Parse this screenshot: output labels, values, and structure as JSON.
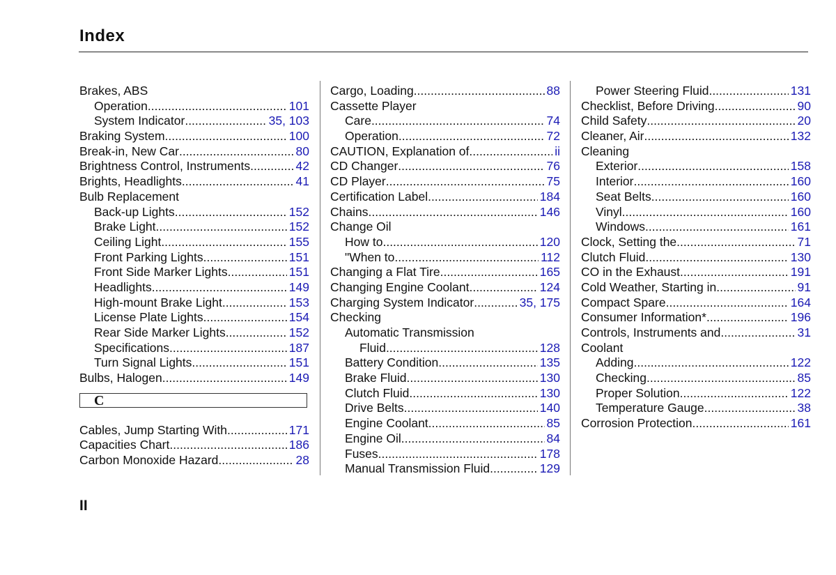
{
  "header": {
    "title": "Index"
  },
  "footer": {
    "page_number": "II"
  },
  "colors": {
    "page_number_link": "#1a1ab4",
    "text": "#111111"
  },
  "columns": [
    {
      "entries_top": [
        {
          "label": "Brakes, ABS",
          "page": "",
          "level": 0
        },
        {
          "label": "Operation",
          "page": "101",
          "level": 1
        },
        {
          "label": "System Indicator",
          "page": "35, 103",
          "level": 1
        },
        {
          "label": "Braking System",
          "page": "100",
          "level": 0
        },
        {
          "label": "Break-in, New Car",
          "page": "80",
          "level": 0
        },
        {
          "label": "Brightness Control, Instruments",
          "page": "42",
          "level": 0
        },
        {
          "label": "Brights, Headlights",
          "page": "41",
          "level": 0
        },
        {
          "label": "Bulb  Replacement",
          "page": "",
          "level": 0
        },
        {
          "label": "Back-up Lights",
          "page": "152",
          "level": 1
        },
        {
          "label": "Brake Light",
          "page": "152",
          "level": 1
        },
        {
          "label": "Ceiling Light",
          "page": "155",
          "level": 1
        },
        {
          "label": "Front Parking Lights",
          "page": "151",
          "level": 1
        },
        {
          "label": "Front Side Marker Lights",
          "page": "151",
          "level": 1
        },
        {
          "label": "Headlights",
          "page": "149",
          "level": 1
        },
        {
          "label": "High-mount Brake Light",
          "page": "153",
          "level": 1
        },
        {
          "label": "License Plate Lights",
          "page": "154",
          "level": 1
        },
        {
          "label": "Rear Side Marker Lights",
          "page": "152",
          "level": 1
        },
        {
          "label": "Specifications",
          "page": "187",
          "level": 1
        },
        {
          "label": "Turn Signal Lights",
          "page": "151",
          "level": 1
        },
        {
          "label": "Bulbs, Halogen",
          "page": "149",
          "level": 0
        }
      ],
      "section_letter": "C",
      "entries_bottom": [
        {
          "label": "Cables, Jump Starting With",
          "page": "171",
          "level": 0
        },
        {
          "label": "Capacities Chart",
          "page": "186",
          "level": 0
        },
        {
          "label": "Carbon Monoxide Hazard",
          "page": "28",
          "level": 0
        }
      ]
    },
    {
      "entries": [
        {
          "label": "Cargo, Loading",
          "page": "88",
          "level": 0
        },
        {
          "label": "Cassette Player",
          "page": "",
          "level": 0
        },
        {
          "label": "Care",
          "page": "74",
          "level": 1
        },
        {
          "label": "Operation",
          "page": "72",
          "level": 1
        },
        {
          "label": "CAUTION, Explanation of",
          "page": "ii",
          "level": 0
        },
        {
          "label": "CD Changer",
          "page": "76",
          "level": 0
        },
        {
          "label": "CD Player",
          "page": "75",
          "level": 0
        },
        {
          "label": "Certification Label",
          "page": "184",
          "level": 0
        },
        {
          "label": "Chains",
          "page": "146",
          "level": 0
        },
        {
          "label": "Change Oil",
          "page": "",
          "level": 0
        },
        {
          "label": "How to",
          "page": "120",
          "level": 1
        },
        {
          "label": "\"When to",
          "page": "112",
          "level": 1
        },
        {
          "label": "Changing a Flat Tire ",
          "page": "165",
          "level": 0
        },
        {
          "label": "Changing Engine Coolant",
          "page": "124",
          "level": 0
        },
        {
          "label": "Charging System Indicator",
          "page": "35, 175",
          "level": 0
        },
        {
          "label": "Checking",
          "page": "",
          "level": 0
        },
        {
          "label": "Automatic Transmission",
          "page": "",
          "level": 1
        },
        {
          "label": "Fluid",
          "page": "128",
          "level": 2
        },
        {
          "label": "Battery Condition",
          "page": "135",
          "level": 1
        },
        {
          "label": "Brake Fluid",
          "page": "130",
          "level": 1
        },
        {
          "label": "Clutch Fluid",
          "page": "130",
          "level": 1
        },
        {
          "label": "Drive Belts",
          "page": "140",
          "level": 1
        },
        {
          "label": "Engine Coolant",
          "page": "85",
          "level": 1
        },
        {
          "label": "Engine Oil",
          "page": "84",
          "level": 1
        },
        {
          "label": "Fuses",
          "page": "178",
          "level": 1
        },
        {
          "label": "Manual Transmission Fluid ",
          "page": "129",
          "level": 1
        }
      ]
    },
    {
      "entries": [
        {
          "label": "Power Steering Fluid",
          "page": "131",
          "level": 1
        },
        {
          "label": "Checklist, Before Driving",
          "page": "90",
          "level": 0
        },
        {
          "label": "Child Safety",
          "page": "20",
          "level": 0
        },
        {
          "label": "Cleaner, Air",
          "page": "132",
          "level": 0
        },
        {
          "label": "Cleaning",
          "page": "",
          "level": 0
        },
        {
          "label": "Exterior",
          "page": "158",
          "level": 1
        },
        {
          "label": "Interior",
          "page": "160",
          "level": 1
        },
        {
          "label": "Seat Belts",
          "page": "160",
          "level": 1
        },
        {
          "label": "Vinyl",
          "page": "160",
          "level": 1
        },
        {
          "label": "Windows",
          "page": "161",
          "level": 1
        },
        {
          "label": "Clock, Setting the ",
          "page": "71",
          "level": 0
        },
        {
          "label": "Clutch Fluid",
          "page": "130",
          "level": 0
        },
        {
          "label": "CO in the Exhaust",
          "page": "191",
          "level": 0
        },
        {
          "label": "Cold Weather, Starting in",
          "page": "91",
          "level": 0
        },
        {
          "label": "Compact Spare",
          "page": "164",
          "level": 0
        },
        {
          "label": "Consumer Information*",
          "page": "196",
          "level": 0
        },
        {
          "label": "Controls, Instruments and",
          "page": "31",
          "level": 0
        },
        {
          "label": "Coolant",
          "page": "",
          "level": 0
        },
        {
          "label": "Adding",
          "page": "122",
          "level": 1
        },
        {
          "label": "Checking",
          "page": "85",
          "level": 1
        },
        {
          "label": "Proper Solution",
          "page": "122",
          "level": 1
        },
        {
          "label": "Temperature Gauge",
          "page": "38",
          "level": 1
        },
        {
          "label": "Corrosion Protection",
          "page": "161",
          "level": 0
        }
      ]
    }
  ]
}
